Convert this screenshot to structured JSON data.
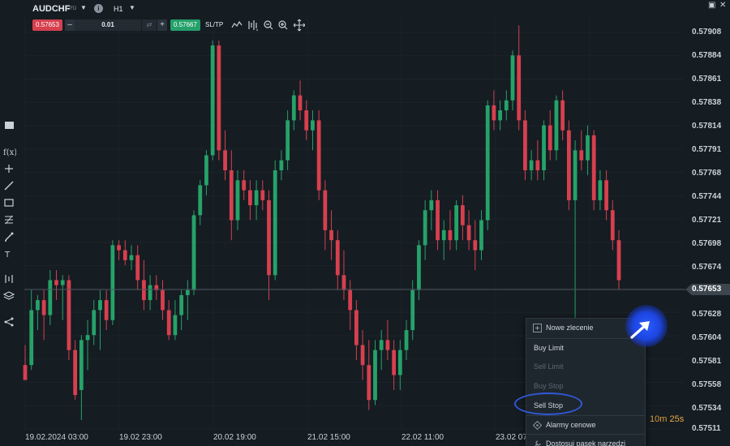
{
  "header": {
    "symbol": "AUDCHF",
    "symbol_type": "CFD",
    "timeframe": "H1"
  },
  "trade_bar": {
    "sell_price": "0.57653",
    "quantity": "0.01",
    "buy_price": "0.57667",
    "sltp_label": "SL/TP"
  },
  "price_axis": {
    "labels": [
      "0.57908",
      "0.57884",
      "0.57861",
      "0.57838",
      "0.57814",
      "0.57791",
      "0.57768",
      "0.57744",
      "0.57721",
      "0.57698",
      "0.57674",
      "0.57653",
      "0.57628",
      "0.57604",
      "0.57581",
      "0.57558",
      "0.57534",
      "0.57511"
    ],
    "current": "0.57653"
  },
  "time_axis": {
    "labels": [
      "19.02.2024 03:00",
      "19.02 23:00",
      "20.02 19:00",
      "21.02 15:00",
      "22.02 11:00",
      "23.02 07"
    ]
  },
  "countdown": {
    "minutes": "10m",
    "seconds": "25s"
  },
  "context_menu": {
    "new_order": "Nowe zlecenie",
    "items": [
      {
        "label": "Buy Limit",
        "enabled": true
      },
      {
        "label": "Sell Limit",
        "enabled": false
      },
      {
        "label": "Buy Stop",
        "enabled": false
      },
      {
        "label": "Sell Stop",
        "enabled": true
      }
    ],
    "price_alerts": "Alarmy cenowe",
    "customize_toolbar": "Dostosuj pasek narzędzi"
  },
  "colors": {
    "background": "#151c22",
    "bull": "#26a269",
    "bear": "#d6404f",
    "accent": "#2f59d9"
  },
  "chart_data": {
    "type": "candlestick",
    "ylim": [
      0.575,
      0.5792
    ],
    "candles": [
      {
        "o": 0.57575,
        "h": 0.57595,
        "l": 0.5756,
        "c": 0.5756
      },
      {
        "o": 0.57575,
        "h": 0.5765,
        "l": 0.5757,
        "c": 0.5763
      },
      {
        "o": 0.5763,
        "h": 0.57645,
        "l": 0.5761,
        "c": 0.5764
      },
      {
        "o": 0.5764,
        "h": 0.5765,
        "l": 0.576,
        "c": 0.57625
      },
      {
        "o": 0.57625,
        "h": 0.5767,
        "l": 0.57615,
        "c": 0.5766
      },
      {
        "o": 0.5766,
        "h": 0.5767,
        "l": 0.5764,
        "c": 0.57655
      },
      {
        "o": 0.57655,
        "h": 0.57665,
        "l": 0.5762,
        "c": 0.5766
      },
      {
        "o": 0.5766,
        "h": 0.57665,
        "l": 0.5758,
        "c": 0.5759
      },
      {
        "o": 0.5759,
        "h": 0.576,
        "l": 0.5754,
        "c": 0.57545
      },
      {
        "o": 0.5755,
        "h": 0.57605,
        "l": 0.5752,
        "c": 0.576
      },
      {
        "o": 0.576,
        "h": 0.5762,
        "l": 0.5757,
        "c": 0.57605
      },
      {
        "o": 0.57605,
        "h": 0.5764,
        "l": 0.57595,
        "c": 0.5763
      },
      {
        "o": 0.5763,
        "h": 0.5765,
        "l": 0.5759,
        "c": 0.5764
      },
      {
        "o": 0.5764,
        "h": 0.5765,
        "l": 0.5761,
        "c": 0.5762
      },
      {
        "o": 0.5762,
        "h": 0.577,
        "l": 0.57615,
        "c": 0.57695
      },
      {
        "o": 0.57695,
        "h": 0.577,
        "l": 0.5768,
        "c": 0.5769
      },
      {
        "o": 0.5769,
        "h": 0.577,
        "l": 0.57675,
        "c": 0.5768
      },
      {
        "o": 0.5768,
        "h": 0.57695,
        "l": 0.5767,
        "c": 0.57685
      },
      {
        "o": 0.57685,
        "h": 0.57695,
        "l": 0.5765,
        "c": 0.5766
      },
      {
        "o": 0.5766,
        "h": 0.5768,
        "l": 0.5763,
        "c": 0.5764
      },
      {
        "o": 0.5764,
        "h": 0.57665,
        "l": 0.5763,
        "c": 0.57655
      },
      {
        "o": 0.57655,
        "h": 0.57665,
        "l": 0.5764,
        "c": 0.5765
      },
      {
        "o": 0.5765,
        "h": 0.5766,
        "l": 0.5762,
        "c": 0.5763
      },
      {
        "o": 0.5763,
        "h": 0.5764,
        "l": 0.576,
        "c": 0.57605
      },
      {
        "o": 0.57605,
        "h": 0.5764,
        "l": 0.576,
        "c": 0.57625
      },
      {
        "o": 0.57625,
        "h": 0.5765,
        "l": 0.5761,
        "c": 0.57645
      },
      {
        "o": 0.57645,
        "h": 0.5766,
        "l": 0.5762,
        "c": 0.5765
      },
      {
        "o": 0.5765,
        "h": 0.5773,
        "l": 0.57645,
        "c": 0.57725
      },
      {
        "o": 0.57725,
        "h": 0.5776,
        "l": 0.57715,
        "c": 0.57755
      },
      {
        "o": 0.57755,
        "h": 0.5779,
        "l": 0.57745,
        "c": 0.57785
      },
      {
        "o": 0.57785,
        "h": 0.579,
        "l": 0.5778,
        "c": 0.57895
      },
      {
        "o": 0.57895,
        "h": 0.579,
        "l": 0.5778,
        "c": 0.5779
      },
      {
        "o": 0.5779,
        "h": 0.5781,
        "l": 0.5776,
        "c": 0.5777
      },
      {
        "o": 0.5777,
        "h": 0.5779,
        "l": 0.577,
        "c": 0.5772
      },
      {
        "o": 0.5772,
        "h": 0.5777,
        "l": 0.5771,
        "c": 0.5776
      },
      {
        "o": 0.5776,
        "h": 0.5777,
        "l": 0.5774,
        "c": 0.5775
      },
      {
        "o": 0.5775,
        "h": 0.5776,
        "l": 0.5772,
        "c": 0.57735
      },
      {
        "o": 0.57735,
        "h": 0.5776,
        "l": 0.5772,
        "c": 0.5775
      },
      {
        "o": 0.5775,
        "h": 0.5776,
        "l": 0.5773,
        "c": 0.5774
      },
      {
        "o": 0.5774,
        "h": 0.5775,
        "l": 0.5764,
        "c": 0.57665
      },
      {
        "o": 0.57665,
        "h": 0.5778,
        "l": 0.5766,
        "c": 0.5777
      },
      {
        "o": 0.5777,
        "h": 0.5779,
        "l": 0.5776,
        "c": 0.5778
      },
      {
        "o": 0.5778,
        "h": 0.5783,
        "l": 0.5777,
        "c": 0.5782
      },
      {
        "o": 0.5782,
        "h": 0.5785,
        "l": 0.5781,
        "c": 0.57845
      },
      {
        "o": 0.57845,
        "h": 0.5786,
        "l": 0.5782,
        "c": 0.5783
      },
      {
        "o": 0.5783,
        "h": 0.5784,
        "l": 0.578,
        "c": 0.5781
      },
      {
        "o": 0.5781,
        "h": 0.5783,
        "l": 0.5779,
        "c": 0.5782
      },
      {
        "o": 0.5782,
        "h": 0.5783,
        "l": 0.5774,
        "c": 0.5775
      },
      {
        "o": 0.5775,
        "h": 0.5776,
        "l": 0.5769,
        "c": 0.5771
      },
      {
        "o": 0.5771,
        "h": 0.5773,
        "l": 0.5768,
        "c": 0.577
      },
      {
        "o": 0.577,
        "h": 0.5771,
        "l": 0.5765,
        "c": 0.57665
      },
      {
        "o": 0.57665,
        "h": 0.5769,
        "l": 0.5764,
        "c": 0.5765
      },
      {
        "o": 0.5765,
        "h": 0.5766,
        "l": 0.5761,
        "c": 0.5763
      },
      {
        "o": 0.5763,
        "h": 0.5764,
        "l": 0.5758,
        "c": 0.57595
      },
      {
        "o": 0.57595,
        "h": 0.5761,
        "l": 0.5756,
        "c": 0.57575
      },
      {
        "o": 0.57575,
        "h": 0.576,
        "l": 0.5753,
        "c": 0.5754
      },
      {
        "o": 0.5754,
        "h": 0.576,
        "l": 0.57535,
        "c": 0.5759
      },
      {
        "o": 0.5759,
        "h": 0.5761,
        "l": 0.5757,
        "c": 0.576
      },
      {
        "o": 0.576,
        "h": 0.5762,
        "l": 0.5758,
        "c": 0.5759
      },
      {
        "o": 0.5759,
        "h": 0.576,
        "l": 0.5755,
        "c": 0.57565
      },
      {
        "o": 0.57565,
        "h": 0.576,
        "l": 0.5755,
        "c": 0.5759
      },
      {
        "o": 0.5759,
        "h": 0.5762,
        "l": 0.5758,
        "c": 0.5761
      },
      {
        "o": 0.5761,
        "h": 0.5766,
        "l": 0.576,
        "c": 0.5765
      },
      {
        "o": 0.5765,
        "h": 0.577,
        "l": 0.5764,
        "c": 0.57695
      },
      {
        "o": 0.57695,
        "h": 0.5774,
        "l": 0.5768,
        "c": 0.5773
      },
      {
        "o": 0.5773,
        "h": 0.5775,
        "l": 0.5771,
        "c": 0.5774
      },
      {
        "o": 0.5774,
        "h": 0.5775,
        "l": 0.5769,
        "c": 0.577
      },
      {
        "o": 0.577,
        "h": 0.5772,
        "l": 0.5768,
        "c": 0.5771
      },
      {
        "o": 0.5771,
        "h": 0.5773,
        "l": 0.5769,
        "c": 0.577
      },
      {
        "o": 0.577,
        "h": 0.5774,
        "l": 0.5769,
        "c": 0.57735
      },
      {
        "o": 0.57735,
        "h": 0.57745,
        "l": 0.577,
        "c": 0.57715
      },
      {
        "o": 0.57715,
        "h": 0.5773,
        "l": 0.5769,
        "c": 0.577
      },
      {
        "o": 0.577,
        "h": 0.5772,
        "l": 0.5767,
        "c": 0.5769
      },
      {
        "o": 0.5769,
        "h": 0.5773,
        "l": 0.5768,
        "c": 0.5772
      },
      {
        "o": 0.5772,
        "h": 0.5784,
        "l": 0.5771,
        "c": 0.57835
      },
      {
        "o": 0.57835,
        "h": 0.5785,
        "l": 0.5781,
        "c": 0.5782
      },
      {
        "o": 0.5782,
        "h": 0.5784,
        "l": 0.5781,
        "c": 0.5783
      },
      {
        "o": 0.5783,
        "h": 0.5785,
        "l": 0.5782,
        "c": 0.5784
      },
      {
        "o": 0.5784,
        "h": 0.5789,
        "l": 0.5783,
        "c": 0.57885
      },
      {
        "o": 0.57885,
        "h": 0.57915,
        "l": 0.5781,
        "c": 0.5782
      },
      {
        "o": 0.5782,
        "h": 0.5783,
        "l": 0.5776,
        "c": 0.5777
      },
      {
        "o": 0.5777,
        "h": 0.5779,
        "l": 0.5776,
        "c": 0.5778
      },
      {
        "o": 0.5778,
        "h": 0.578,
        "l": 0.5776,
        "c": 0.5777
      },
      {
        "o": 0.5777,
        "h": 0.5782,
        "l": 0.5776,
        "c": 0.57815
      },
      {
        "o": 0.57815,
        "h": 0.5783,
        "l": 0.5778,
        "c": 0.5779
      },
      {
        "o": 0.5779,
        "h": 0.57845,
        "l": 0.5778,
        "c": 0.5784
      },
      {
        "o": 0.5784,
        "h": 0.5785,
        "l": 0.578,
        "c": 0.5781
      },
      {
        "o": 0.5781,
        "h": 0.5782,
        "l": 0.5773,
        "c": 0.5774
      },
      {
        "o": 0.5774,
        "h": 0.578,
        "l": 0.5762,
        "c": 0.5779
      },
      {
        "o": 0.5779,
        "h": 0.5781,
        "l": 0.5777,
        "c": 0.5778
      },
      {
        "o": 0.5778,
        "h": 0.57815,
        "l": 0.57765,
        "c": 0.57805
      },
      {
        "o": 0.57805,
        "h": 0.5781,
        "l": 0.5773,
        "c": 0.5774
      },
      {
        "o": 0.5774,
        "h": 0.5777,
        "l": 0.5773,
        "c": 0.5776
      },
      {
        "o": 0.5776,
        "h": 0.5777,
        "l": 0.5772,
        "c": 0.5773
      },
      {
        "o": 0.5773,
        "h": 0.5774,
        "l": 0.5769,
        "c": 0.577
      },
      {
        "o": 0.577,
        "h": 0.5771,
        "l": 0.5765,
        "c": 0.5766
      }
    ]
  }
}
